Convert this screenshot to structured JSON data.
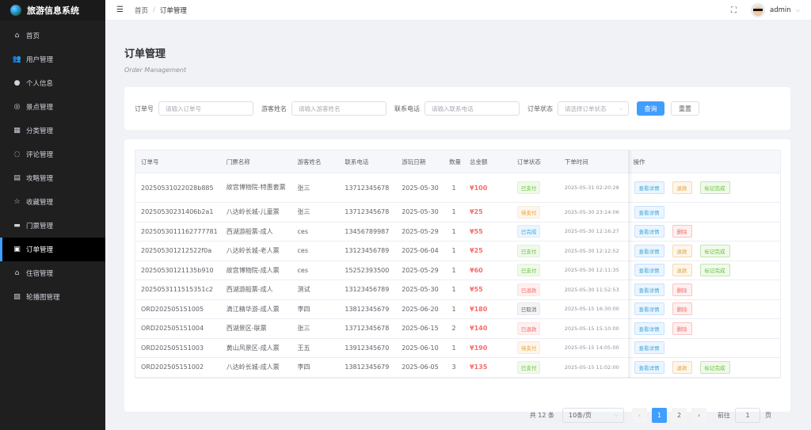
{
  "app": {
    "title": "旅游信息系统"
  },
  "sidebar": {
    "items": [
      {
        "label": "首页",
        "icon": "home-icon",
        "glyph": "⌂",
        "active": false
      },
      {
        "label": "用户管理",
        "icon": "users-icon",
        "glyph": "👥",
        "active": false
      },
      {
        "label": "个人信息",
        "icon": "user-icon",
        "glyph": "●",
        "active": false
      },
      {
        "label": "景点管理",
        "icon": "location-icon",
        "glyph": "◎",
        "active": false
      },
      {
        "label": "分类管理",
        "icon": "grid-icon",
        "glyph": "▦",
        "active": false
      },
      {
        "label": "评论管理",
        "icon": "comment-icon",
        "glyph": "◌",
        "active": false
      },
      {
        "label": "攻略管理",
        "icon": "document-icon",
        "glyph": "▤",
        "active": false
      },
      {
        "label": "收藏管理",
        "icon": "star-icon",
        "glyph": "☆",
        "active": false
      },
      {
        "label": "门票管理",
        "icon": "ticket-icon",
        "glyph": "▬",
        "active": false
      },
      {
        "label": "订单管理",
        "icon": "order-icon",
        "glyph": "▣",
        "active": true
      },
      {
        "label": "住宿管理",
        "icon": "house-icon",
        "glyph": "⌂",
        "active": false
      },
      {
        "label": "轮播图管理",
        "icon": "picture-icon",
        "glyph": "▨",
        "active": false
      }
    ]
  },
  "header": {
    "breadcrumb": [
      "首页",
      "订单管理"
    ],
    "breadcrumb_sep": "/",
    "username": "admin"
  },
  "page": {
    "title": "订单管理",
    "subtitle": "Order Management"
  },
  "search": {
    "order_no_label": "订单号",
    "order_no_placeholder": "请输入订单号",
    "name_label": "游客姓名",
    "name_placeholder": "请输入游客姓名",
    "phone_label": "联系电话",
    "phone_placeholder": "请输入联系电话",
    "status_label": "订单状态",
    "status_placeholder": "请选择订单状态",
    "query_button": "查询",
    "reset_button": "重置"
  },
  "table": {
    "columns": [
      "订单号",
      "门票名称",
      "游客姓名",
      "联系电话",
      "游玩日期",
      "数量",
      "总金额",
      "订单状态",
      "下单时间",
      "操作"
    ],
    "rows": [
      {
        "order_no": "20250531022028b885",
        "ticket": "故宫博物院-特惠套票",
        "name": "张三",
        "phone": "13712345678",
        "date": "2025-05-30",
        "qty": "1",
        "amount": "¥100",
        "status": "已支付",
        "status_type": "success",
        "time": "2025-05-31 02:20:28",
        "ops": [
          {
            "label": "查看详情",
            "type": "detail"
          },
          {
            "label": "退款",
            "type": "refund"
          },
          {
            "label": "标记完成",
            "type": "done"
          }
        ]
      },
      {
        "order_no": "20250530231406b2a1",
        "ticket": "八达岭长城-儿童票",
        "name": "张三",
        "phone": "13712345678",
        "date": "2025-05-30",
        "qty": "1",
        "amount": "¥25",
        "status": "待支付",
        "status_type": "warning",
        "time": "2025-05-30 23:14:06",
        "ops": [
          {
            "label": "查看详情",
            "type": "detail"
          }
        ]
      },
      {
        "order_no": "20250530111627778 1",
        "ticket": "西湖游船票-成人",
        "name": "ces",
        "phone": "13456789987",
        "date": "2025-05-29",
        "qty": "1",
        "amount": "¥55",
        "status": "已完成",
        "status_type": "info",
        "time": "2025-05-30 12:16:27",
        "ops": [
          {
            "label": "查看详情",
            "type": "detail"
          },
          {
            "label": "删除",
            "type": "delete"
          }
        ]
      },
      {
        "order_no": "20250530121252 2f0a",
        "ticket": "八达岭长城-老人票",
        "name": "ces",
        "phone": "13123456789",
        "date": "2025-06-04",
        "qty": "1",
        "amount": "¥25",
        "status": "已支付",
        "status_type": "success",
        "time": "2025-05-30 12:12:52",
        "ops": [
          {
            "label": "查看详情",
            "type": "detail"
          },
          {
            "label": "退款",
            "type": "refund"
          },
          {
            "label": "标记完成",
            "type": "done"
          }
        ]
      },
      {
        "order_no": "20250530121135b910",
        "ticket": "故宫博物院-成人票",
        "name": "ces",
        "phone": "15252393500",
        "date": "2025-05-29",
        "qty": "1",
        "amount": "¥60",
        "status": "已支付",
        "status_type": "success",
        "time": "2025-05-30 12:11:35",
        "ops": [
          {
            "label": "查看详情",
            "type": "detail"
          },
          {
            "label": "退款",
            "type": "refund"
          },
          {
            "label": "标记完成",
            "type": "done"
          }
        ]
      },
      {
        "order_no": "2025053111515351c2",
        "ticket": "西湖游船票-成人",
        "name": "测试",
        "phone": "13123456789",
        "date": "2025-05-30",
        "qty": "1",
        "amount": "¥55",
        "status": "已退款",
        "status_type": "danger",
        "time": "2025-05-30 11:52:53",
        "ops": [
          {
            "label": "查看详情",
            "type": "detail"
          },
          {
            "label": "删除",
            "type": "delete"
          }
        ]
      },
      {
        "order_no": "ORD202505151005",
        "ticket": "滴江精华游-成人票",
        "name": "李四",
        "phone": "13812345679",
        "date": "2025-06-20",
        "qty": "1",
        "amount": "¥180",
        "status": "已取消",
        "status_type": "gray",
        "time": "2025-05-15 16:30:00",
        "ops": [
          {
            "label": "查看详情",
            "type": "detail"
          },
          {
            "label": "删除",
            "type": "delete"
          }
        ]
      },
      {
        "order_no": "ORD202505151004",
        "ticket": "西湖景区-联票",
        "name": "张三",
        "phone": "13712345678",
        "date": "2025-06-15",
        "qty": "2",
        "amount": "¥140",
        "status": "已退款",
        "status_type": "danger",
        "time": "2025-05-15 15:10:00",
        "ops": [
          {
            "label": "查看详情",
            "type": "detail"
          },
          {
            "label": "删除",
            "type": "delete"
          }
        ]
      },
      {
        "order_no": "ORD202505151003",
        "ticket": "黄山风景区-成人票",
        "name": "王五",
        "phone": "13912345670",
        "date": "2025-06-10",
        "qty": "1",
        "amount": "¥190",
        "status": "待支付",
        "status_type": "warning",
        "time": "2025-05-15 14:05:00",
        "ops": [
          {
            "label": "查看详情",
            "type": "detail"
          }
        ]
      },
      {
        "order_no": "ORD202505151002",
        "ticket": "八达岭长城-成人票",
        "name": "李四",
        "phone": "13812345679",
        "date": "2025-06-05",
        "qty": "3",
        "amount": "¥135",
        "status": "已支付",
        "status_type": "success",
        "time": "2025-05-15 11:02:00",
        "ops": [
          {
            "label": "查看详情",
            "type": "detail"
          },
          {
            "label": "退款",
            "type": "refund"
          },
          {
            "label": "标记完成",
            "type": "done"
          }
        ]
      }
    ]
  },
  "pagination": {
    "total": "共 12 条",
    "page_size": "10条/页",
    "prev": "‹",
    "pages": [
      "1",
      "2"
    ],
    "current": "1",
    "next": "›",
    "goto_label": "前往",
    "goto_value": "1",
    "goto_suffix": "页"
  }
}
